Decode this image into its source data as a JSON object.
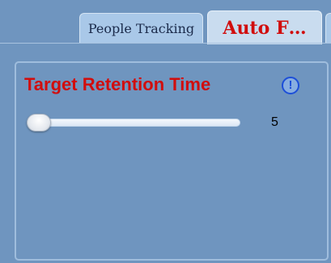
{
  "tabs": [
    {
      "label": "People Tracking",
      "active": false
    },
    {
      "label": "Auto F…",
      "active": true
    }
  ],
  "section": {
    "title": "Target Retention Time",
    "info_icon": "info-circle-icon"
  },
  "slider": {
    "value": "5",
    "level_fraction": 0.0
  },
  "colors": {
    "background": "#6f95bf",
    "title_red": "#d10d0d",
    "info_blue": "#1d4fd8",
    "active_tab": "#c9dcef",
    "inactive_tab": "#a9c8e8"
  }
}
